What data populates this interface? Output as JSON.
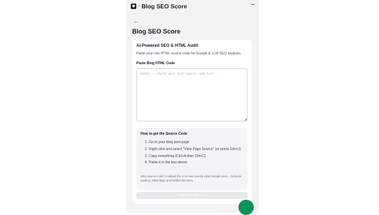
{
  "topbar": {
    "logo_glyph": "◆",
    "separator": "›",
    "title": "Blog SEO Score",
    "more_glyph": "···"
  },
  "nav": {
    "back_glyph": "←"
  },
  "page": {
    "title": "Blog SEO Score"
  },
  "card": {
    "title": "AI-Powered SEO & HTML Audit",
    "description": "Paste your raw HTML source code for Google & LLM SEO analysis.",
    "field_label": "Paste Blog HTML Code",
    "field_placeholder": "<html>... Paste your full source code here ...",
    "field_value": ""
  },
  "help": {
    "title": "How to get the Source Code",
    "steps": [
      {
        "num": "1.",
        "text": "Go to your blog post page"
      },
      {
        "num": "2.",
        "text": "Right-click and select \"View Page Source\" (or press Ctrl+U)"
      },
      {
        "num": "3.",
        "text": "Copy everything (Ctrl+A then Ctrl+C)"
      },
      {
        "num": "4.",
        "text": "Paste it in the box above"
      }
    ],
    "note": "Why source code? It allows the AI to see exactly what Google sees – Schema markup, Meta tags, and hidden structure."
  },
  "actions": {
    "analyze_label": "Analyze HTML Code"
  },
  "colors": {
    "accent": "#10915a",
    "panel_bg": "#f3f3f3",
    "button_disabled": "#e5e7eb"
  }
}
